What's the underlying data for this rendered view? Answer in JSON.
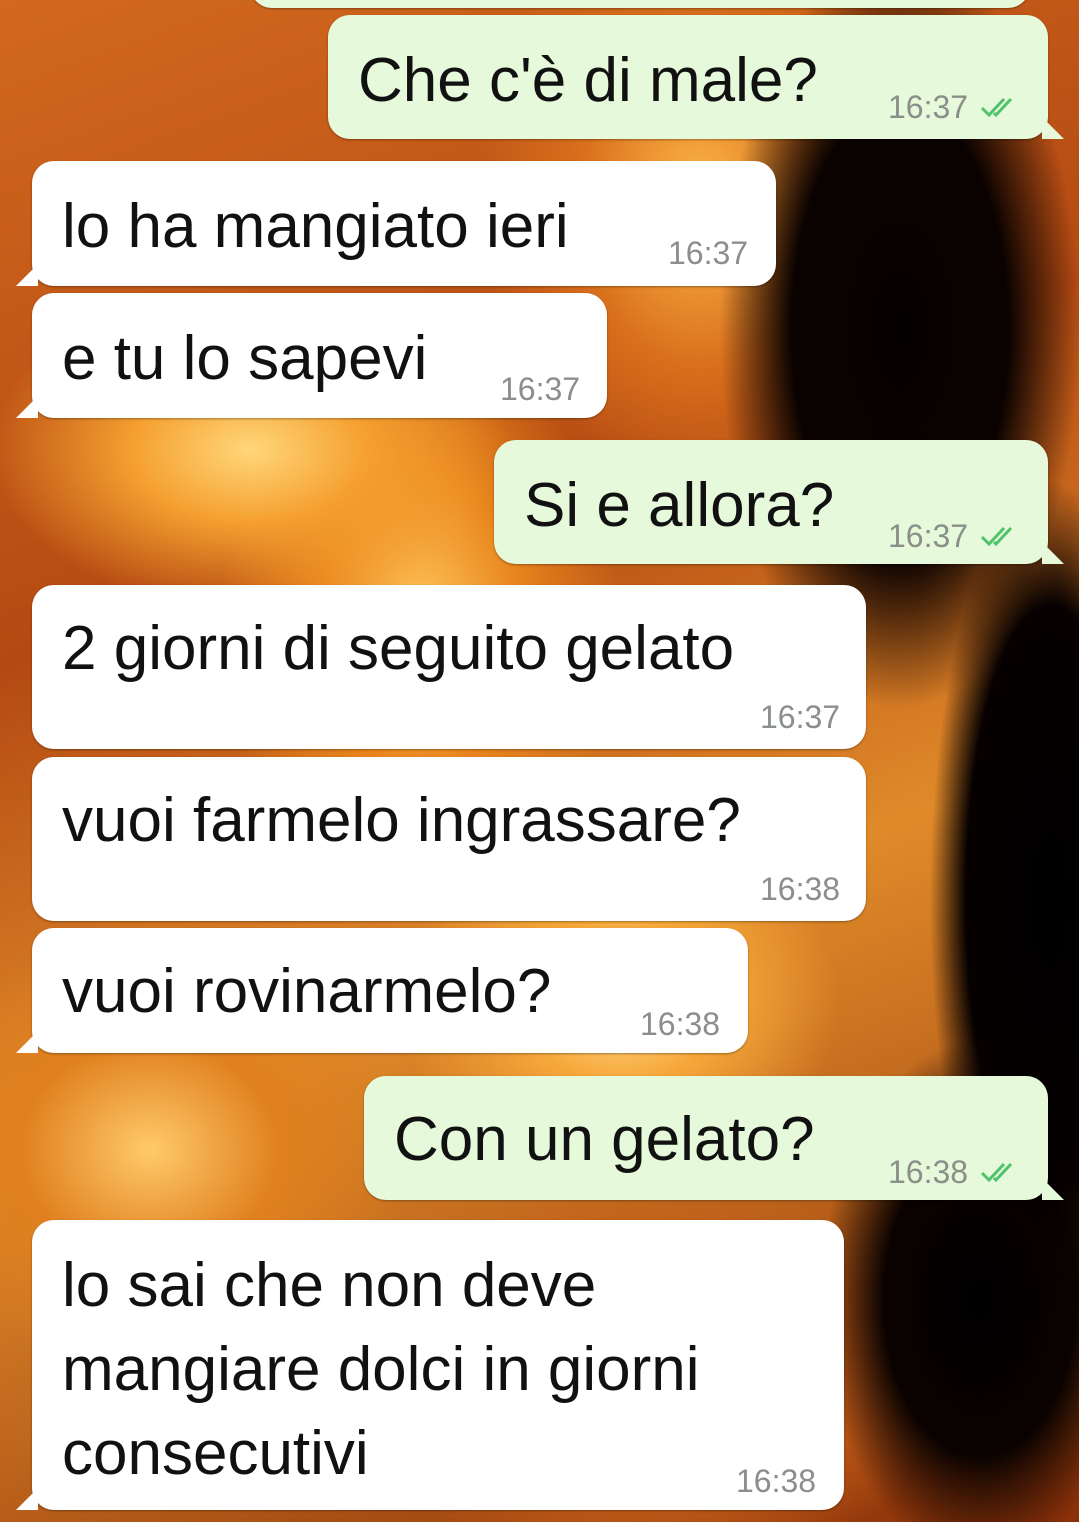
{
  "messages": [
    {
      "text": "",
      "time": "",
      "direction": "in"
    },
    {
      "text": "Che c'è di male?",
      "time": "16:37",
      "direction": "out",
      "status": "read"
    },
    {
      "text": "lo ha mangiato ieri",
      "time": "16:37",
      "direction": "in"
    },
    {
      "text": "e tu lo sapevi",
      "time": "16:37",
      "direction": "in"
    },
    {
      "text": "Si e allora?",
      "time": "16:37",
      "direction": "out",
      "status": "read"
    },
    {
      "text": "2 giorni di seguito gelato",
      "time": "16:37",
      "direction": "in"
    },
    {
      "text": "vuoi farmelo ingrassare?",
      "time": "16:38",
      "direction": "in"
    },
    {
      "text": "vuoi rovinarmelo?",
      "time": "16:38",
      "direction": "in"
    },
    {
      "text": "Con un gelato?",
      "time": "16:38",
      "direction": "out",
      "status": "read"
    },
    {
      "text": "lo sai che non deve mangiare dolci in giorni consecutivi",
      "time": "16:38",
      "direction": "in"
    }
  ],
  "colors": {
    "incoming_bubble": "#ffffff",
    "outgoing_bubble": "#e6f9da",
    "read_ticks": "#4fc36b",
    "timestamp": "#8a8f8a"
  },
  "icons": {
    "read_receipt": "double-check-icon"
  }
}
